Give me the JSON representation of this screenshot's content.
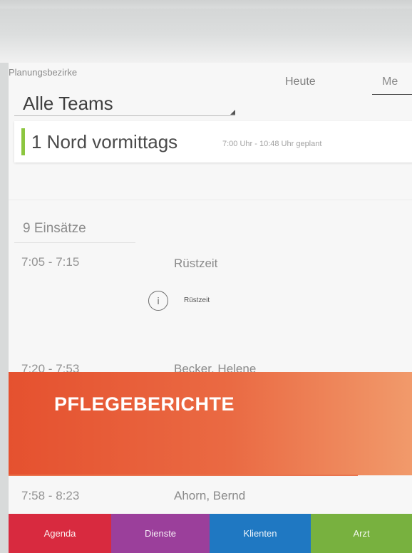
{
  "header": {
    "planning_label": "Planungsbezirke",
    "team_select_value": "Alle Teams",
    "tabs": [
      {
        "label": "Heute"
      },
      {
        "label": "Me"
      }
    ]
  },
  "tour": {
    "title": "1 Nord vormittags",
    "time_info": "7:00 Uhr - 10:48 Uhr geplant"
  },
  "assignments": {
    "count_label": "9 Einsätze",
    "items": [
      {
        "time": "7:05 - 7:15",
        "client": "Rüstzeit",
        "info": "Rüstzeit"
      },
      {
        "time": "7:20 - 7:53",
        "client": "Becker, Helene"
      },
      {
        "time": "7:58 - 8:23",
        "client": "Ahorn, Bernd"
      }
    ]
  },
  "banner": {
    "title": "PFLEGEBERICHTE"
  },
  "bottom_nav": [
    {
      "label": "Agenda",
      "color": "#d82a3f"
    },
    {
      "label": "Dienste",
      "color": "#9b3f9b"
    },
    {
      "label": "Klienten",
      "color": "#1f78c2"
    },
    {
      "label": "Arzt",
      "color": "#78b13f"
    }
  ]
}
